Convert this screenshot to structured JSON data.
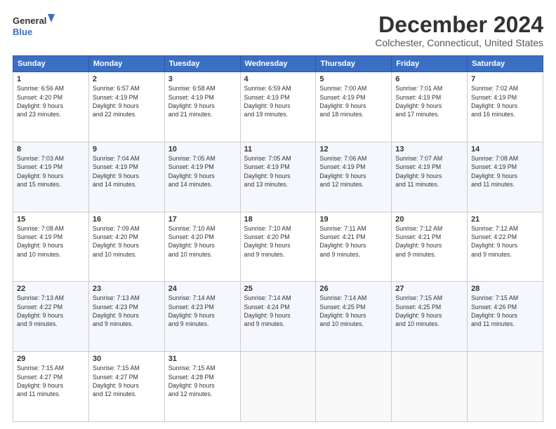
{
  "header": {
    "logo_line1": "General",
    "logo_line2": "Blue",
    "month": "December 2024",
    "location": "Colchester, Connecticut, United States"
  },
  "days_of_week": [
    "Sunday",
    "Monday",
    "Tuesday",
    "Wednesday",
    "Thursday",
    "Friday",
    "Saturday"
  ],
  "weeks": [
    [
      {
        "day": "1",
        "info": "Sunrise: 6:56 AM\nSunset: 4:20 PM\nDaylight: 9 hours\nand 23 minutes."
      },
      {
        "day": "2",
        "info": "Sunrise: 6:57 AM\nSunset: 4:19 PM\nDaylight: 9 hours\nand 22 minutes."
      },
      {
        "day": "3",
        "info": "Sunrise: 6:58 AM\nSunset: 4:19 PM\nDaylight: 9 hours\nand 21 minutes."
      },
      {
        "day": "4",
        "info": "Sunrise: 6:59 AM\nSunset: 4:19 PM\nDaylight: 9 hours\nand 19 minutes."
      },
      {
        "day": "5",
        "info": "Sunrise: 7:00 AM\nSunset: 4:19 PM\nDaylight: 9 hours\nand 18 minutes."
      },
      {
        "day": "6",
        "info": "Sunrise: 7:01 AM\nSunset: 4:19 PM\nDaylight: 9 hours\nand 17 minutes."
      },
      {
        "day": "7",
        "info": "Sunrise: 7:02 AM\nSunset: 4:19 PM\nDaylight: 9 hours\nand 16 minutes."
      }
    ],
    [
      {
        "day": "8",
        "info": "Sunrise: 7:03 AM\nSunset: 4:19 PM\nDaylight: 9 hours\nand 15 minutes."
      },
      {
        "day": "9",
        "info": "Sunrise: 7:04 AM\nSunset: 4:19 PM\nDaylight: 9 hours\nand 14 minutes."
      },
      {
        "day": "10",
        "info": "Sunrise: 7:05 AM\nSunset: 4:19 PM\nDaylight: 9 hours\nand 14 minutes."
      },
      {
        "day": "11",
        "info": "Sunrise: 7:05 AM\nSunset: 4:19 PM\nDaylight: 9 hours\nand 13 minutes."
      },
      {
        "day": "12",
        "info": "Sunrise: 7:06 AM\nSunset: 4:19 PM\nDaylight: 9 hours\nand 12 minutes."
      },
      {
        "day": "13",
        "info": "Sunrise: 7:07 AM\nSunset: 4:19 PM\nDaylight: 9 hours\nand 11 minutes."
      },
      {
        "day": "14",
        "info": "Sunrise: 7:08 AM\nSunset: 4:19 PM\nDaylight: 9 hours\nand 11 minutes."
      }
    ],
    [
      {
        "day": "15",
        "info": "Sunrise: 7:08 AM\nSunset: 4:19 PM\nDaylight: 9 hours\nand 10 minutes."
      },
      {
        "day": "16",
        "info": "Sunrise: 7:09 AM\nSunset: 4:20 PM\nDaylight: 9 hours\nand 10 minutes."
      },
      {
        "day": "17",
        "info": "Sunrise: 7:10 AM\nSunset: 4:20 PM\nDaylight: 9 hours\nand 10 minutes."
      },
      {
        "day": "18",
        "info": "Sunrise: 7:10 AM\nSunset: 4:20 PM\nDaylight: 9 hours\nand 9 minutes."
      },
      {
        "day": "19",
        "info": "Sunrise: 7:11 AM\nSunset: 4:21 PM\nDaylight: 9 hours\nand 9 minutes."
      },
      {
        "day": "20",
        "info": "Sunrise: 7:12 AM\nSunset: 4:21 PM\nDaylight: 9 hours\nand 9 minutes."
      },
      {
        "day": "21",
        "info": "Sunrise: 7:12 AM\nSunset: 4:22 PM\nDaylight: 9 hours\nand 9 minutes."
      }
    ],
    [
      {
        "day": "22",
        "info": "Sunrise: 7:13 AM\nSunset: 4:22 PM\nDaylight: 9 hours\nand 9 minutes."
      },
      {
        "day": "23",
        "info": "Sunrise: 7:13 AM\nSunset: 4:23 PM\nDaylight: 9 hours\nand 9 minutes."
      },
      {
        "day": "24",
        "info": "Sunrise: 7:14 AM\nSunset: 4:23 PM\nDaylight: 9 hours\nand 9 minutes."
      },
      {
        "day": "25",
        "info": "Sunrise: 7:14 AM\nSunset: 4:24 PM\nDaylight: 9 hours\nand 9 minutes."
      },
      {
        "day": "26",
        "info": "Sunrise: 7:14 AM\nSunset: 4:25 PM\nDaylight: 9 hours\nand 10 minutes."
      },
      {
        "day": "27",
        "info": "Sunrise: 7:15 AM\nSunset: 4:25 PM\nDaylight: 9 hours\nand 10 minutes."
      },
      {
        "day": "28",
        "info": "Sunrise: 7:15 AM\nSunset: 4:26 PM\nDaylight: 9 hours\nand 11 minutes."
      }
    ],
    [
      {
        "day": "29",
        "info": "Sunrise: 7:15 AM\nSunset: 4:27 PM\nDaylight: 9 hours\nand 11 minutes."
      },
      {
        "day": "30",
        "info": "Sunrise: 7:15 AM\nSunset: 4:27 PM\nDaylight: 9 hours\nand 12 minutes."
      },
      {
        "day": "31",
        "info": "Sunrise: 7:15 AM\nSunset: 4:28 PM\nDaylight: 9 hours\nand 12 minutes."
      },
      null,
      null,
      null,
      null
    ]
  ]
}
